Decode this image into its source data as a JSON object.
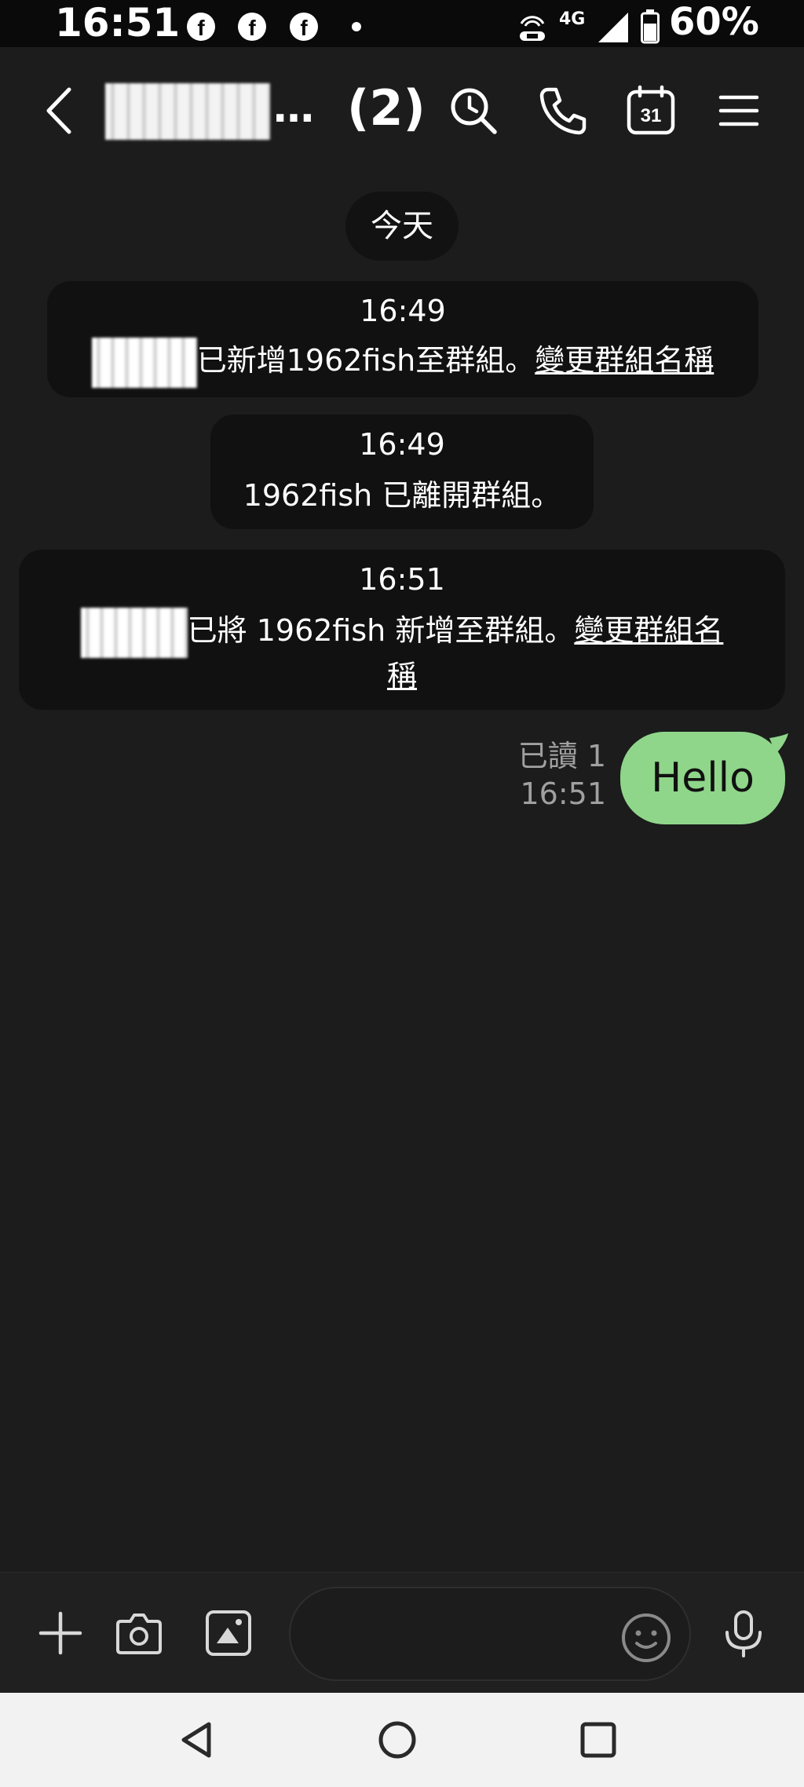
{
  "status_bar": {
    "time": "16:51",
    "notification_icons": [
      "facebook-icon",
      "facebook-icon",
      "facebook-icon"
    ],
    "network_label": "4G",
    "battery_percent": "60%"
  },
  "header": {
    "ellipsis": "…",
    "member_count": "(2)",
    "icons": [
      "back-icon",
      "search-icon",
      "phone-icon",
      "calendar-icon",
      "menu-icon"
    ],
    "calendar_day": "31"
  },
  "chat": {
    "date_label": "今天",
    "system_messages": [
      {
        "time": "16:49",
        "text": "已新增1962fish至群組。",
        "link": "變更群組名稱"
      },
      {
        "time": "16:49",
        "text": "1962fish 已離開群組。"
      },
      {
        "time": "16:51",
        "text": "已將 1962fish 新增至群組。",
        "link_line1": "變更群組名",
        "link_line2": "稱"
      }
    ],
    "sent_message": {
      "read_status": "已讀 1",
      "time": "16:51",
      "text": "Hello"
    }
  },
  "input_bar": {
    "icons": [
      "plus-icon",
      "camera-icon",
      "image-icon",
      "emoji-icon",
      "mic-icon"
    ],
    "placeholder": ""
  },
  "nav_bar": {
    "icons": [
      "back-nav-icon",
      "home-nav-icon",
      "recents-nav-icon"
    ]
  },
  "colors": {
    "background": "#1c1c1c",
    "sent_bubble": "#8fd68b",
    "system_card": "#111111",
    "nav_bar": "#f2f2f2"
  }
}
